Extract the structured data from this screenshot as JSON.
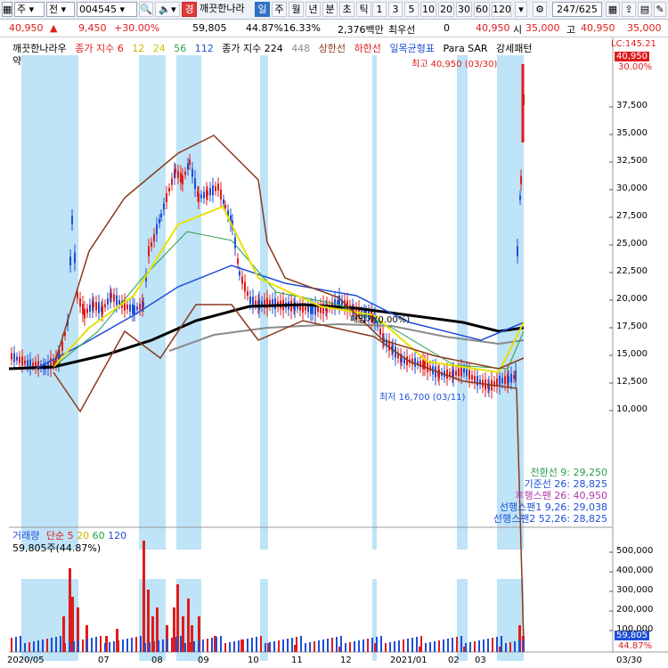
{
  "toolbar": {
    "type_label": "주",
    "mode_label": "전",
    "code": "004545",
    "badge": "경",
    "name": "깨끗한나라",
    "periods": [
      "일",
      "주",
      "월",
      "년",
      "분",
      "초",
      "틱"
    ],
    "active_period": "일",
    "intervals": [
      "1",
      "3",
      "5",
      "10",
      "20",
      "30",
      "60",
      "120"
    ],
    "page": "247/625"
  },
  "quote": {
    "price": "40,950",
    "change": "9,450",
    "change_pct": "+30.00%",
    "volume": "59,805",
    "vol_ratio": "44.87%",
    "turnover_pct": "16.33%",
    "amount": "2,376백만",
    "preferred_label": "최우선",
    "preferred_value": "0",
    "price2": "40,950",
    "open_label": "시",
    "open": "35,000",
    "high_label": "고",
    "high": "40,950",
    "low": "35,000"
  },
  "legend": {
    "name": "깨끗한나라우",
    "ma_label": "종가 지수 6",
    "ma12": "12",
    "ma24": "24",
    "ma56": "56",
    "ma112": "112",
    "ma224_label": "종가 지수 224",
    "ma448": "448",
    "limit_up": "상한선",
    "limit_down": "하한선",
    "ichimoku": "일목균형표",
    "psar": "Para SAR",
    "strong_pattern": "강세패턴",
    "weak_pattern": "약세패턴"
  },
  "annotations": {
    "high_text": "최고 40,950 (03/30)",
    "low_text": "최저 16,700 (03/11)",
    "mid_text": "매입가(0.00%)",
    "lc": "LC:145.21",
    "last_price_tag": "40,950",
    "pct_tag": "30.00%"
  },
  "ichimoku_values": [
    {
      "label": "전환선 9: 29,250",
      "color": "#2a9d4a"
    },
    {
      "label": "기준선 26: 28,825",
      "color": "#1f4fd6"
    },
    {
      "label": "후행스팬 26: 40,950",
      "color": "#b03aa8"
    },
    {
      "label": "선행스팬1 9,26: 29,038",
      "color": "#1f4fd6"
    },
    {
      "label": "선행스팬2 52,26: 28,825",
      "color": "#1f4fd6"
    }
  ],
  "volume_panel": {
    "title": "거래량",
    "ma_label": "단순 5",
    "ma20": "20",
    "ma60": "60",
    "ma120": "120",
    "current": "59,805주(44.87%)",
    "last_tag": "59,805",
    "pct_tag": "44.87%"
  },
  "price_axis": [
    "37,500",
    "35,000",
    "32,500",
    "30,000",
    "27,500",
    "25,000",
    "22,500",
    "20,000",
    "17,500",
    "15,000",
    "12,500",
    "10,000"
  ],
  "volume_axis": [
    "500,000",
    "400,000",
    "300,000",
    "200,000",
    "100,000"
  ],
  "date_axis": [
    "2020/05",
    "07",
    "08",
    "09",
    "10",
    "11",
    "12",
    "2021/01",
    "02",
    "03",
    "03/30"
  ],
  "colors": {
    "up": "#e01b1b",
    "down": "#1f4fd6",
    "highlight": "#bfe3f7",
    "ma224": "#000000",
    "ma448": "#8a8a8a",
    "bollinger": "#8b3a1a"
  }
}
